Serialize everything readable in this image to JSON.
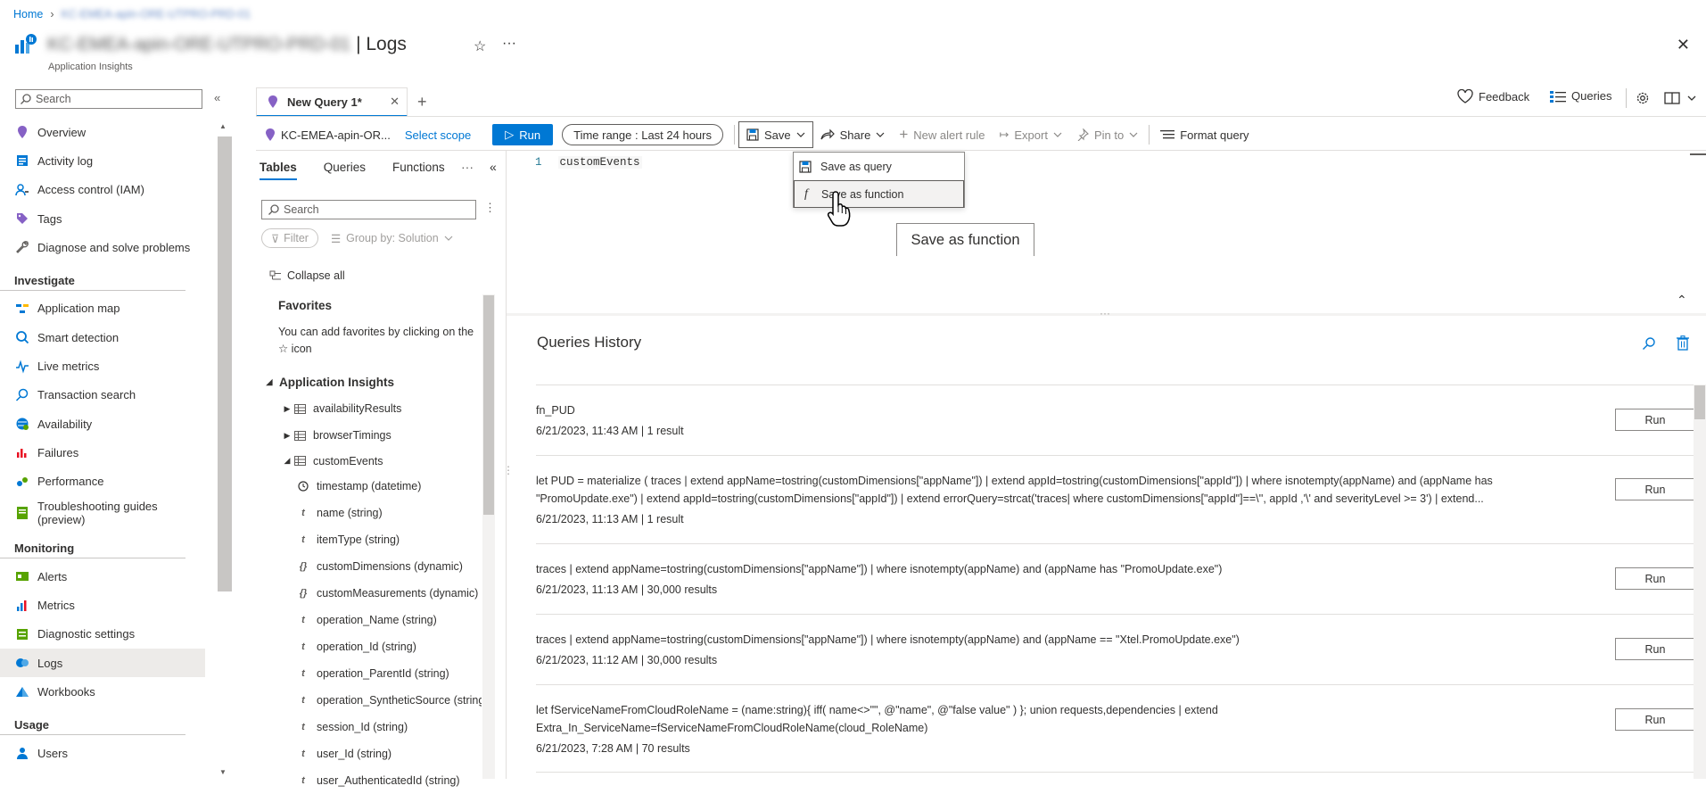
{
  "breadcrumb": {
    "home": "Home",
    "resource": "KC-EMEA-apin-ORE-UTPRO-PRD-01"
  },
  "header": {
    "title_blurred": "KC-EMEA-apin-ORE-UTPRO-PRD-01",
    "title_suffix": "| Logs",
    "subtitle": "Application Insights",
    "star_icon": "☆",
    "more_icon": "···",
    "close_icon": "✕"
  },
  "nav": {
    "search_placeholder": "Search",
    "collapse": "«",
    "items": [
      {
        "label": "Overview",
        "icon": "overview-icon",
        "color": "#8661c5"
      },
      {
        "label": "Activity log",
        "icon": "activity-log-icon",
        "color": "#0078d4"
      },
      {
        "label": "Access control (IAM)",
        "icon": "iam-icon",
        "color": "#0078d4"
      },
      {
        "label": "Tags",
        "icon": "tag-icon",
        "color": "#8661c5"
      },
      {
        "label": "Diagnose and solve problems",
        "icon": "wrench-icon",
        "color": "#605e5c"
      }
    ],
    "investigate": {
      "heading": "Investigate",
      "items": [
        {
          "label": "Application map",
          "icon": "app-map-icon"
        },
        {
          "label": "Smart detection",
          "icon": "smart-detection-icon"
        },
        {
          "label": "Live metrics",
          "icon": "live-metrics-icon"
        },
        {
          "label": "Transaction search",
          "icon": "transaction-search-icon"
        },
        {
          "label": "Availability",
          "icon": "availability-icon"
        },
        {
          "label": "Failures",
          "icon": "failures-icon"
        },
        {
          "label": "Performance",
          "icon": "performance-icon"
        },
        {
          "label": "Troubleshooting guides",
          "label2": "(preview)",
          "icon": "troubleshooting-icon"
        }
      ]
    },
    "monitoring": {
      "heading": "Monitoring",
      "items": [
        {
          "label": "Alerts",
          "icon": "alerts-icon"
        },
        {
          "label": "Metrics",
          "icon": "metrics-icon"
        },
        {
          "label": "Diagnostic settings",
          "icon": "diagnostic-settings-icon"
        },
        {
          "label": "Logs",
          "icon": "logs-icon",
          "active": true
        },
        {
          "label": "Workbooks",
          "icon": "workbooks-icon"
        }
      ]
    },
    "usage": {
      "heading": "Usage",
      "items": [
        {
          "label": "Users",
          "icon": "users-icon"
        }
      ]
    }
  },
  "tabs": {
    "active": "New Query 1*",
    "close": "✕",
    "add": "+"
  },
  "top_right": {
    "feedback": "Feedback",
    "queries": "Queries"
  },
  "toolbar": {
    "scope": "KC-EMEA-apin-OR...",
    "select_scope": "Select scope",
    "run": "Run",
    "time_range": "Time range :  Last 24 hours",
    "save": "Save",
    "share": "Share",
    "new_alert": "New alert rule",
    "export": "Export",
    "pin": "Pin to",
    "format": "Format query"
  },
  "save_menu": {
    "items": [
      "Save as query",
      "Save as function"
    ],
    "tooltip": "Save as function"
  },
  "schema": {
    "tabs": [
      "Tables",
      "Queries",
      "Functions"
    ],
    "more": "···",
    "collapse": "«",
    "search_placeholder": "Search",
    "filter": "Filter",
    "group_by": "Group by: Solution",
    "collapse_all": "Collapse all",
    "favorites_title": "Favorites",
    "favorites_desc": "You can add favorites by clicking on the ☆ icon",
    "root": "Application Insights",
    "tables": [
      {
        "label": "availabilityResults",
        "expanded": false
      },
      {
        "label": "browserTimings",
        "expanded": false
      },
      {
        "label": "customEvents",
        "expanded": true
      }
    ],
    "columns": [
      {
        "label": "timestamp (datetime)",
        "icon": "clock-icon"
      },
      {
        "label": "name (string)",
        "icon": "t"
      },
      {
        "label": "itemType (string)",
        "icon": "t"
      },
      {
        "label": "customDimensions (dynamic)",
        "icon": "{}"
      },
      {
        "label": "customMeasurements (dynamic)",
        "icon": "{}"
      },
      {
        "label": "operation_Name (string)",
        "icon": "t"
      },
      {
        "label": "operation_Id (string)",
        "icon": "t"
      },
      {
        "label": "operation_ParentId (string)",
        "icon": "t"
      },
      {
        "label": "operation_SyntheticSource (string)",
        "icon": "t"
      },
      {
        "label": "session_Id (string)",
        "icon": "t"
      },
      {
        "label": "user_Id (string)",
        "icon": "t"
      },
      {
        "label": "user_AuthenticatedId (string)",
        "icon": "t"
      }
    ]
  },
  "editor": {
    "line_number": "1",
    "code": "customEvents"
  },
  "history": {
    "title": "Queries History",
    "run_label": "Run",
    "rows": [
      {
        "text": "fn_PUD",
        "meta": "6/21/2023, 11:43 AM | 1 result"
      },
      {
        "text": "let PUD = materialize ( traces | extend appName=tostring(customDimensions[\"appName\"]) | extend appId=tostring(customDimensions[\"appId\"]) | where isnotempty(appName) and (appName has \"PromoUpdate.exe\") | extend appId=tostring(customDimensions[\"appId\"]) | extend errorQuery=strcat('traces| where customDimensions[\"appId\"]==\\'', appId ,'\\' and severityLevel >= 3') | extend...",
        "meta": "6/21/2023, 11:13 AM | 1 result"
      },
      {
        "text": "traces | extend appName=tostring(customDimensions[\"appName\"]) | where isnotempty(appName) and (appName has \"PromoUpdate.exe\")",
        "meta": "6/21/2023, 11:13 AM | 30,000 results"
      },
      {
        "text": "traces | extend appName=tostring(customDimensions[\"appName\"]) | where isnotempty(appName) and (appName == \"Xtel.PromoUpdate.exe\")",
        "meta": "6/21/2023, 11:12 AM | 30,000 results"
      },
      {
        "text": "let fServiceNameFromCloudRoleName = (name:string){ iff( name<>\"\", @\"name\", @\"false value\" ) }; union requests,dependencies | extend Extra_In_ServiceName=fServiceNameFromCloudRoleName(cloud_RoleName)",
        "meta": "6/21/2023, 7:28 AM | 70 results"
      }
    ]
  },
  "colors": {
    "accent": "#0078d4",
    "nav_active": "#edebe9"
  }
}
